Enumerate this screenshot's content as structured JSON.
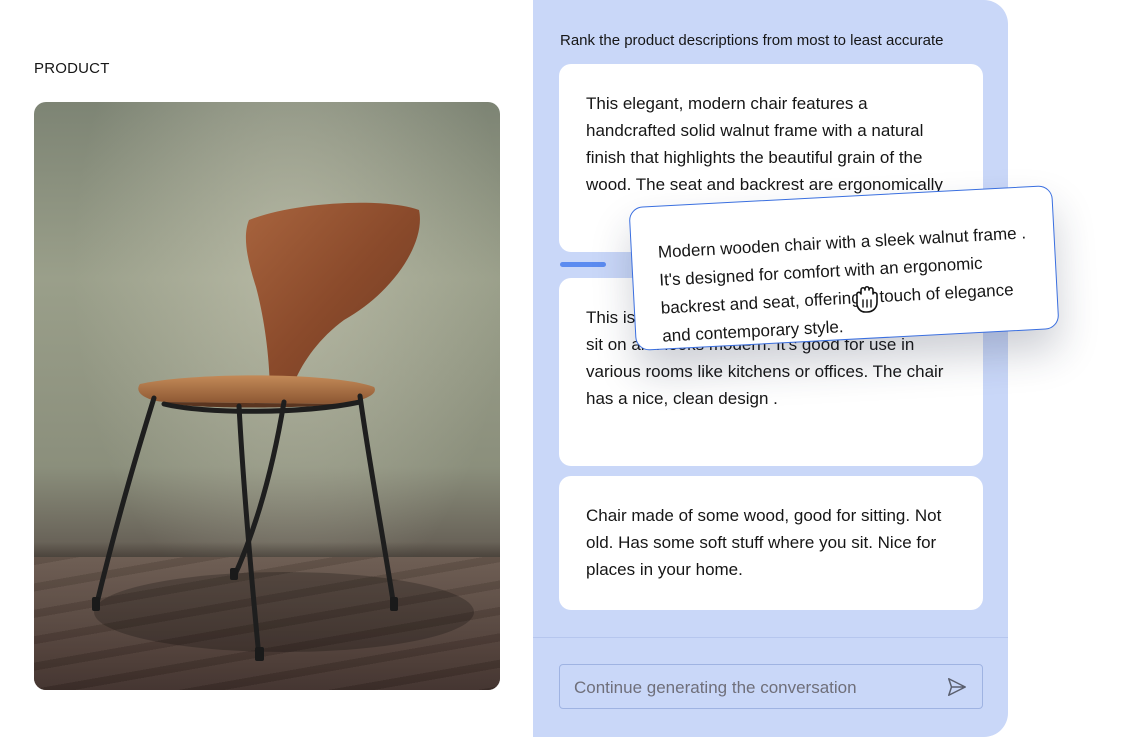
{
  "product": {
    "label": "PRODUCT",
    "image_alt": "chair-photo"
  },
  "ranking": {
    "instruction": "Rank the product descriptions from most to least accurate",
    "cards": [
      {
        "text": "This elegant, modern chair features a handcrafted solid walnut frame with a natural finish that highlights the beautiful grain of the wood. The seat and backrest are ergonomically"
      },
      {
        "text": "This is a chair made of wood. It's comfortable to sit on and looks modern. It's good for use in various rooms like kitchens or offices. The chair has a nice, clean design ."
      },
      {
        "text": "Chair made of some wood, good for sitting. Not old. Has some soft stuff where you sit. Nice for places in your home."
      }
    ],
    "dragging_card": {
      "text": "Modern wooden chair with a sleek walnut frame . It's designed for comfort with an ergonomic backrest and seat, offering a touch of elegance and contemporary style."
    }
  },
  "composer": {
    "placeholder": "Continue generating the conversation",
    "send_icon": "send-icon"
  },
  "colors": {
    "panel_bg": "#c9d7f8",
    "accent": "#3a6fe0",
    "card_bg": "#ffffff"
  }
}
